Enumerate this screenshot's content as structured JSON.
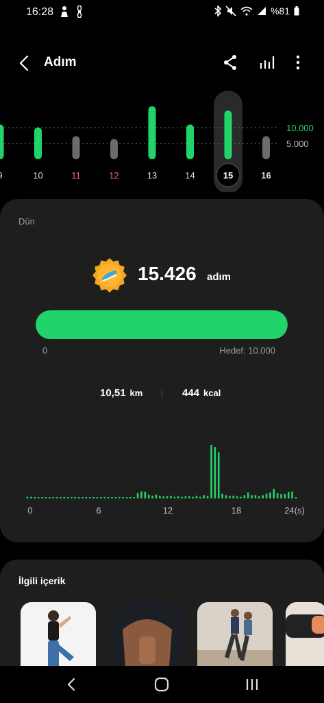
{
  "status_bar": {
    "time": "16:28",
    "battery": "%81",
    "icons": [
      "person-icon",
      "fan-icon",
      "bluetooth-icon",
      "mute-icon",
      "wifi-icon",
      "signal-icon",
      "battery-icon"
    ]
  },
  "app_bar": {
    "title": "Adım",
    "icons": [
      "back-icon",
      "share-icon",
      "stats-icon",
      "more-icon"
    ]
  },
  "week_chart": {
    "goal_label": "10.000",
    "half_label": "5.000",
    "accent": "#22d36a",
    "days": [
      {
        "label": "9",
        "steps": 11000,
        "met": true,
        "style": "normal"
      },
      {
        "label": "10",
        "steps": 10100,
        "met": true,
        "style": "normal"
      },
      {
        "label": "11",
        "steps": 7300,
        "met": false,
        "style": "weekend"
      },
      {
        "label": "12",
        "steps": 6400,
        "met": false,
        "style": "weekend"
      },
      {
        "label": "13",
        "steps": 16800,
        "met": true,
        "style": "normal"
      },
      {
        "label": "14",
        "steps": 11000,
        "met": true,
        "style": "normal"
      },
      {
        "label": "15",
        "steps": 15426,
        "met": true,
        "style": "selected"
      },
      {
        "label": "16",
        "steps": 7300,
        "met": false,
        "style": "bold"
      }
    ]
  },
  "today": {
    "day_label": "Dün",
    "steps": "15.426",
    "unit": "adım",
    "progress_fraction": 1.0,
    "progress_min": "0",
    "goal_text": "Hedef: 10.000",
    "distance_value": "10,51",
    "distance_unit": "km",
    "calories_value": "444",
    "calories_unit": "kcal"
  },
  "hourly_chart": {
    "x_labels": [
      "0",
      "6",
      "12",
      "18",
      "24(s)"
    ],
    "values": [
      0.03,
      0.03,
      0.02,
      0.02,
      0.02,
      0.02,
      0.02,
      0.02,
      0.02,
      0.02,
      0.02,
      0.02,
      0.02,
      0.02,
      0.02,
      0.02,
      0.02,
      0.02,
      0.02,
      0.02,
      0.02,
      0.02,
      0.02,
      0.02,
      0.02,
      0.02,
      0.02,
      0.02,
      0.02,
      0.02,
      0.1,
      0.13,
      0.12,
      0.07,
      0.05,
      0.07,
      0.05,
      0.04,
      0.04,
      0.05,
      0.03,
      0.04,
      0.03,
      0.04,
      0.04,
      0.03,
      0.05,
      0.03,
      0.06,
      0.05,
      1.0,
      0.96,
      0.86,
      0.09,
      0.06,
      0.05,
      0.05,
      0.04,
      0.03,
      0.06,
      0.11,
      0.06,
      0.06,
      0.04,
      0.06,
      0.09,
      0.11,
      0.18,
      0.1,
      0.08,
      0.08,
      0.12,
      0.13,
      0.0
    ]
  },
  "related": {
    "title": "İlgili içerik",
    "thumbnails": [
      "stretching-woman",
      "fitness-man",
      "runners",
      "plank"
    ]
  }
}
